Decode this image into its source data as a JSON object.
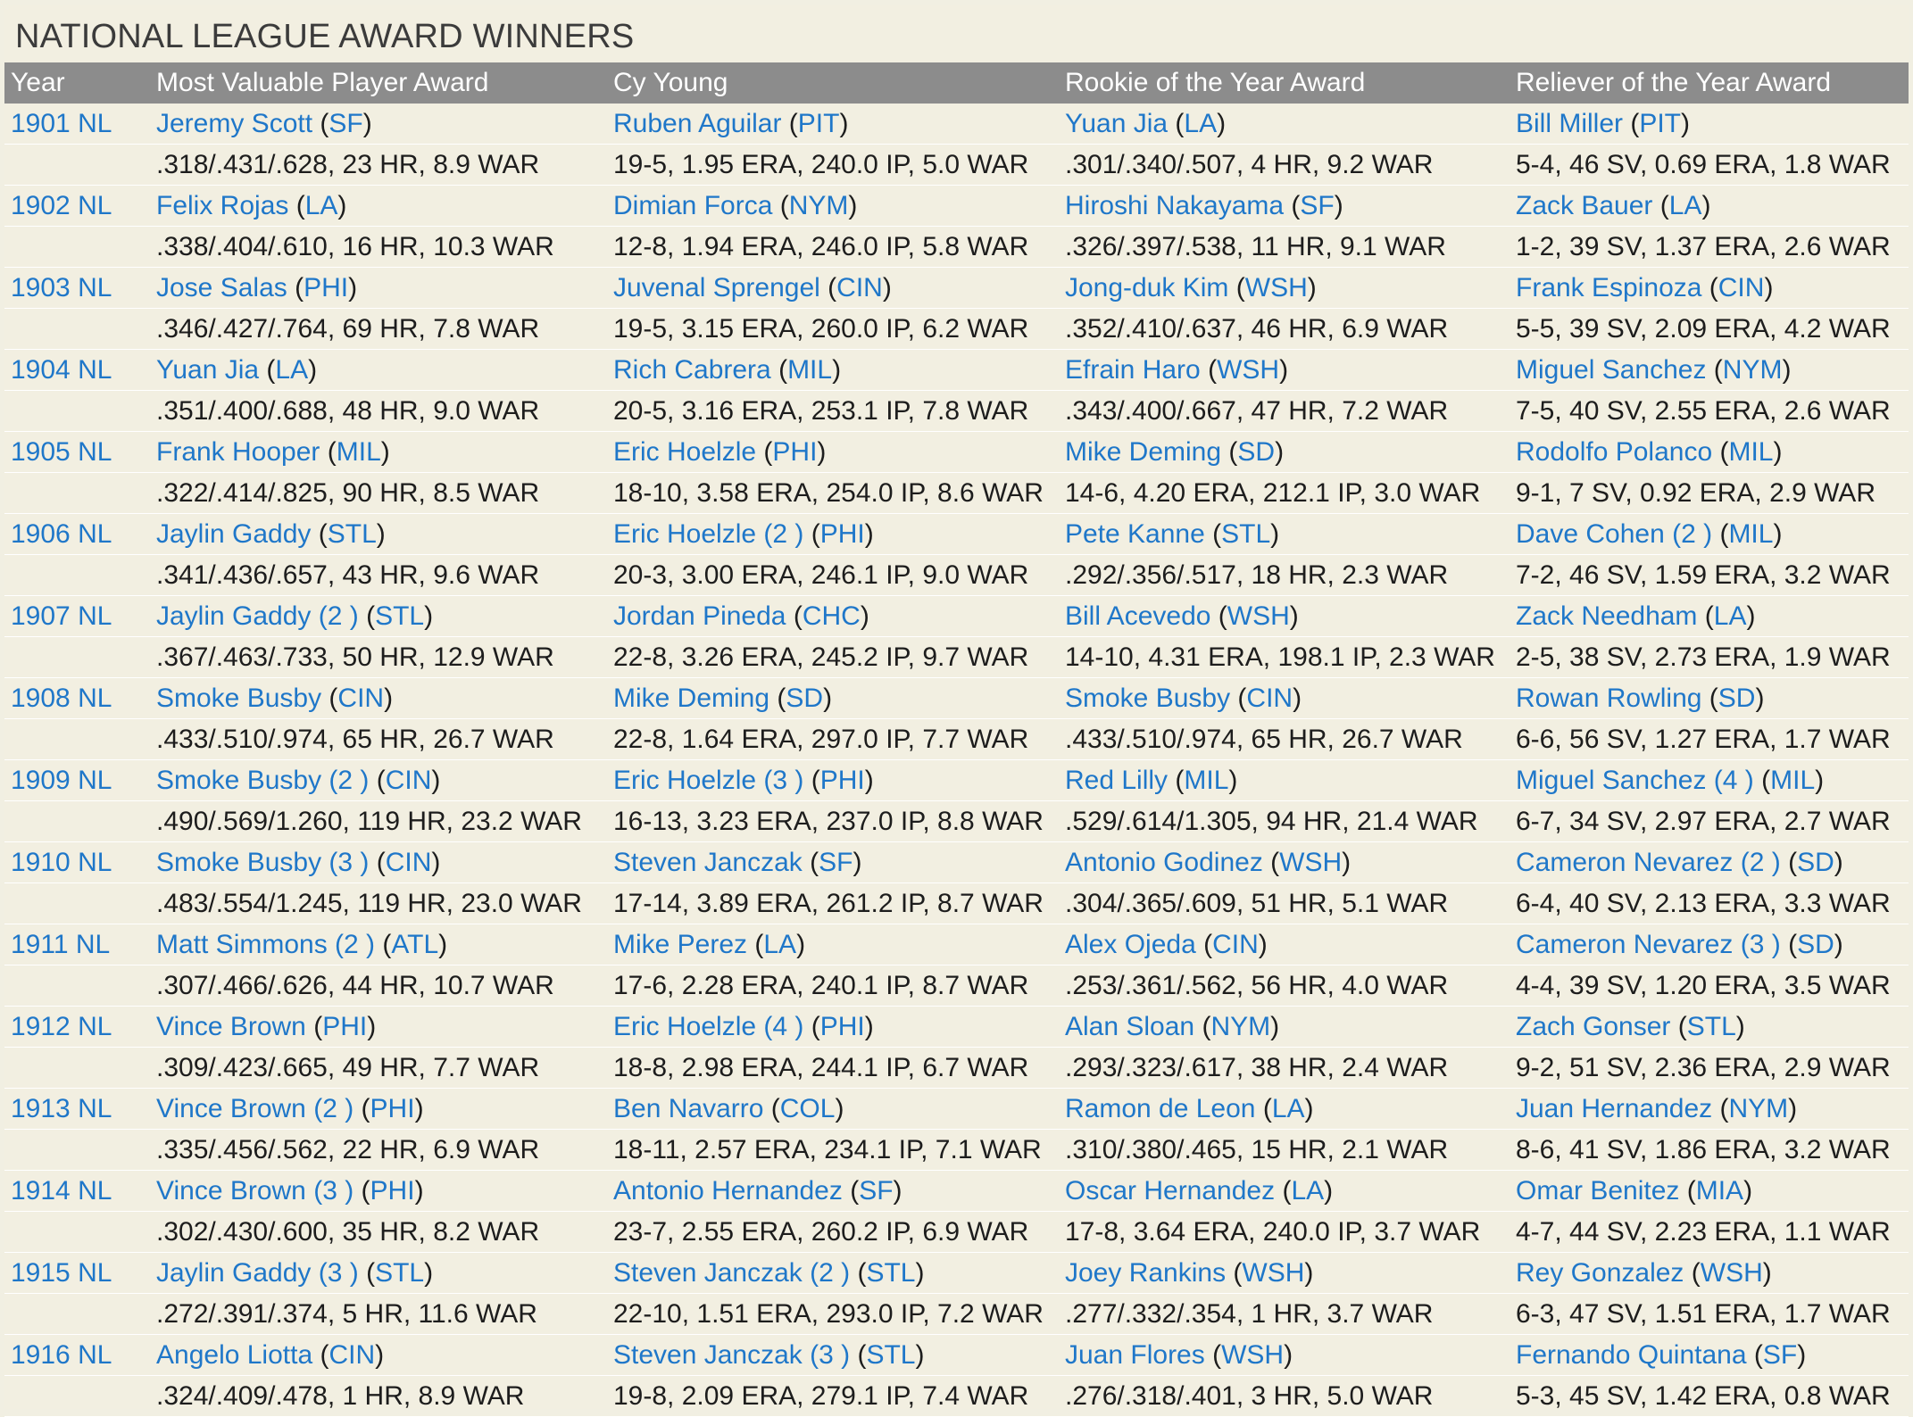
{
  "title": "NATIONAL LEAGUE AWARD WINNERS",
  "colors": {
    "link": "#1f77c9",
    "header_bg": "#8c8c8c",
    "page_bg": "#f2efe1",
    "text": "#1d1d1d"
  },
  "headers": [
    "Year",
    "Most Valuable Player Award",
    "Cy Young",
    "Rookie of the Year Award",
    "Reliever of the Year Award"
  ],
  "rows": [
    {
      "year": "1901 NL",
      "mvp": {
        "name": "Jeremy Scott",
        "team": "SF",
        "stats": ".318/.431/.628, 23 HR, 8.9 WAR"
      },
      "cy": {
        "name": "Ruben Aguilar",
        "team": "PIT",
        "stats": "19-5, 1.95 ERA, 240.0 IP, 5.0 WAR"
      },
      "roy": {
        "name": "Yuan Jia",
        "team": "LA",
        "stats": ".301/.340/.507, 4 HR, 9.2 WAR"
      },
      "rel": {
        "name": "Bill Miller",
        "team": "PIT",
        "stats": "5-4, 46 SV, 0.69 ERA, 1.8 WAR"
      }
    },
    {
      "year": "1902 NL",
      "mvp": {
        "name": "Felix Rojas",
        "team": "LA",
        "stats": ".338/.404/.610, 16 HR, 10.3 WAR"
      },
      "cy": {
        "name": "Dimian Forca",
        "team": "NYM",
        "stats": "12-8, 1.94 ERA, 246.0 IP, 5.8 WAR"
      },
      "roy": {
        "name": "Hiroshi Nakayama",
        "team": "SF",
        "stats": ".326/.397/.538, 11 HR, 9.1 WAR"
      },
      "rel": {
        "name": "Zack Bauer",
        "team": "LA",
        "stats": "1-2, 39 SV, 1.37 ERA, 2.6 WAR"
      }
    },
    {
      "year": "1903 NL",
      "mvp": {
        "name": "Jose Salas",
        "team": "PHI",
        "stats": ".346/.427/.764, 69 HR, 7.8 WAR"
      },
      "cy": {
        "name": "Juvenal Sprengel",
        "team": "CIN",
        "stats": "19-5, 3.15 ERA, 260.0 IP, 6.2 WAR"
      },
      "roy": {
        "name": "Jong-duk Kim",
        "team": "WSH",
        "stats": ".352/.410/.637, 46 HR, 6.9 WAR"
      },
      "rel": {
        "name": "Frank Espinoza",
        "team": "CIN",
        "stats": "5-5, 39 SV, 2.09 ERA, 4.2 WAR"
      }
    },
    {
      "year": "1904 NL",
      "mvp": {
        "name": "Yuan Jia",
        "team": "LA",
        "stats": ".351/.400/.688, 48 HR, 9.0 WAR"
      },
      "cy": {
        "name": "Rich Cabrera",
        "team": "MIL",
        "stats": "20-5, 3.16 ERA, 253.1 IP, 7.8 WAR"
      },
      "roy": {
        "name": "Efrain Haro",
        "team": "WSH",
        "stats": ".343/.400/.667, 47 HR, 7.2 WAR"
      },
      "rel": {
        "name": "Miguel Sanchez",
        "team": "NYM",
        "stats": "7-5, 40 SV, 2.55 ERA, 2.6 WAR"
      }
    },
    {
      "year": "1905 NL",
      "mvp": {
        "name": "Frank Hooper",
        "team": "MIL",
        "stats": ".322/.414/.825, 90 HR, 8.5 WAR"
      },
      "cy": {
        "name": "Eric Hoelzle",
        "team": "PHI",
        "stats": "18-10, 3.58 ERA, 254.0 IP, 8.6 WAR"
      },
      "roy": {
        "name": "Mike Deming",
        "team": "SD",
        "stats": "14-6, 4.20 ERA, 212.1 IP, 3.0 WAR"
      },
      "rel": {
        "name": "Rodolfo Polanco",
        "team": "MIL",
        "stats": "9-1, 7 SV, 0.92 ERA, 2.9 WAR"
      }
    },
    {
      "year": "1906 NL",
      "mvp": {
        "name": "Jaylin Gaddy",
        "team": "STL",
        "stats": ".341/.436/.657, 43 HR, 9.6 WAR"
      },
      "cy": {
        "name": "Eric Hoelzle (2 )",
        "team": "PHI",
        "stats": "20-3, 3.00 ERA, 246.1 IP, 9.0 WAR"
      },
      "roy": {
        "name": "Pete Kanne",
        "team": "STL",
        "stats": ".292/.356/.517, 18 HR, 2.3 WAR"
      },
      "rel": {
        "name": "Dave Cohen (2 )",
        "team": "MIL",
        "stats": "7-2, 46 SV, 1.59 ERA, 3.2 WAR"
      }
    },
    {
      "year": "1907 NL",
      "mvp": {
        "name": "Jaylin Gaddy (2 )",
        "team": "STL",
        "stats": ".367/.463/.733, 50 HR, 12.9 WAR"
      },
      "cy": {
        "name": "Jordan Pineda",
        "team": "CHC",
        "stats": "22-8, 3.26 ERA, 245.2 IP, 9.7 WAR"
      },
      "roy": {
        "name": "Bill Acevedo",
        "team": "WSH",
        "stats": "14-10, 4.31 ERA, 198.1 IP, 2.3 WAR"
      },
      "rel": {
        "name": "Zack Needham",
        "team": "LA",
        "stats": "2-5, 38 SV, 2.73 ERA, 1.9 WAR"
      }
    },
    {
      "year": "1908 NL",
      "mvp": {
        "name": "Smoke Busby",
        "team": "CIN",
        "stats": ".433/.510/.974, 65 HR, 26.7 WAR"
      },
      "cy": {
        "name": "Mike Deming",
        "team": "SD",
        "stats": "22-8, 1.64 ERA, 297.0 IP, 7.7 WAR"
      },
      "roy": {
        "name": "Smoke Busby",
        "team": "CIN",
        "stats": ".433/.510/.974, 65 HR, 26.7 WAR"
      },
      "rel": {
        "name": "Rowan Rowling",
        "team": "SD",
        "stats": "6-6, 56 SV, 1.27 ERA, 1.7 WAR"
      }
    },
    {
      "year": "1909 NL",
      "mvp": {
        "name": "Smoke Busby (2 )",
        "team": "CIN",
        "stats": ".490/.569/1.260, 119 HR, 23.2 WAR"
      },
      "cy": {
        "name": "Eric Hoelzle (3 )",
        "team": "PHI",
        "stats": "16-13, 3.23 ERA, 237.0 IP, 8.8 WAR"
      },
      "roy": {
        "name": "Red Lilly",
        "team": "MIL",
        "stats": ".529/.614/1.305, 94 HR, 21.4 WAR"
      },
      "rel": {
        "name": "Miguel Sanchez (4 )",
        "team": "MIL",
        "stats": "6-7, 34 SV, 2.97 ERA, 2.7 WAR"
      }
    },
    {
      "year": "1910 NL",
      "mvp": {
        "name": "Smoke Busby (3 )",
        "team": "CIN",
        "stats": ".483/.554/1.245, 119 HR, 23.0 WAR"
      },
      "cy": {
        "name": "Steven Janczak",
        "team": "SF",
        "stats": "17-14, 3.89 ERA, 261.2 IP, 8.7 WAR"
      },
      "roy": {
        "name": "Antonio Godinez",
        "team": "WSH",
        "stats": ".304/.365/.609, 51 HR, 5.1 WAR"
      },
      "rel": {
        "name": "Cameron Nevarez (2 )",
        "team": "SD",
        "stats": "6-4, 40 SV, 2.13 ERA, 3.3 WAR"
      }
    },
    {
      "year": "1911 NL",
      "mvp": {
        "name": "Matt Simmons (2 )",
        "team": "ATL",
        "stats": ".307/.466/.626, 44 HR, 10.7 WAR"
      },
      "cy": {
        "name": "Mike Perez",
        "team": "LA",
        "stats": "17-6, 2.28 ERA, 240.1 IP, 8.7 WAR"
      },
      "roy": {
        "name": "Alex Ojeda",
        "team": "CIN",
        "stats": ".253/.361/.562, 56 HR, 4.0 WAR"
      },
      "rel": {
        "name": "Cameron Nevarez (3 )",
        "team": "SD",
        "stats": "4-4, 39 SV, 1.20 ERA, 3.5 WAR"
      }
    },
    {
      "year": "1912 NL",
      "mvp": {
        "name": "Vince Brown",
        "team": "PHI",
        "stats": ".309/.423/.665, 49 HR, 7.7 WAR"
      },
      "cy": {
        "name": "Eric Hoelzle (4 )",
        "team": "PHI",
        "stats": "18-8, 2.98 ERA, 244.1 IP, 6.7 WAR"
      },
      "roy": {
        "name": "Alan Sloan",
        "team": "NYM",
        "stats": ".293/.323/.617, 38 HR, 2.4 WAR"
      },
      "rel": {
        "name": "Zach Gonser",
        "team": "STL",
        "stats": "9-2, 51 SV, 2.36 ERA, 2.9 WAR"
      }
    },
    {
      "year": "1913 NL",
      "mvp": {
        "name": "Vince Brown (2 )",
        "team": "PHI",
        "stats": ".335/.456/.562, 22 HR, 6.9 WAR"
      },
      "cy": {
        "name": "Ben Navarro",
        "team": "COL",
        "stats": "18-11, 2.57 ERA, 234.1 IP, 7.1 WAR"
      },
      "roy": {
        "name": "Ramon de Leon",
        "team": "LA",
        "stats": ".310/.380/.465, 15 HR, 2.1 WAR"
      },
      "rel": {
        "name": "Juan Hernandez",
        "team": "NYM",
        "stats": "8-6, 41 SV, 1.86 ERA, 3.2 WAR"
      }
    },
    {
      "year": "1914 NL",
      "mvp": {
        "name": "Vince Brown (3 )",
        "team": "PHI",
        "stats": ".302/.430/.600, 35 HR, 8.2 WAR"
      },
      "cy": {
        "name": "Antonio Hernandez",
        "team": "SF",
        "stats": "23-7, 2.55 ERA, 260.2 IP, 6.9 WAR"
      },
      "roy": {
        "name": "Oscar Hernandez",
        "team": "LA",
        "stats": "17-8, 3.64 ERA, 240.0 IP, 3.7 WAR"
      },
      "rel": {
        "name": "Omar Benitez",
        "team": "MIA",
        "stats": "4-7, 44 SV, 2.23 ERA, 1.1 WAR"
      }
    },
    {
      "year": "1915 NL",
      "mvp": {
        "name": "Jaylin Gaddy (3 )",
        "team": "STL",
        "stats": ".272/.391/.374, 5 HR, 11.6 WAR"
      },
      "cy": {
        "name": "Steven Janczak (2 )",
        "team": "STL",
        "stats": "22-10, 1.51 ERA, 293.0 IP, 7.2 WAR"
      },
      "roy": {
        "name": "Joey Rankins",
        "team": "WSH",
        "stats": ".277/.332/.354, 1 HR, 3.7 WAR"
      },
      "rel": {
        "name": "Rey Gonzalez",
        "team": "WSH",
        "stats": "6-3, 47 SV, 1.51 ERA, 1.7 WAR"
      }
    },
    {
      "year": "1916 NL",
      "mvp": {
        "name": "Angelo Liotta",
        "team": "CIN",
        "stats": ".324/.409/.478, 1 HR, 8.9 WAR"
      },
      "cy": {
        "name": "Steven Janczak (3 )",
        "team": "STL",
        "stats": "19-8, 2.09 ERA, 279.1 IP, 7.4 WAR"
      },
      "roy": {
        "name": "Juan Flores",
        "team": "WSH",
        "stats": ".276/.318/.401, 3 HR, 5.0 WAR"
      },
      "rel": {
        "name": "Fernando Quintana",
        "team": "SF",
        "stats": "5-3, 45 SV, 1.42 ERA, 0.8 WAR"
      }
    }
  ]
}
